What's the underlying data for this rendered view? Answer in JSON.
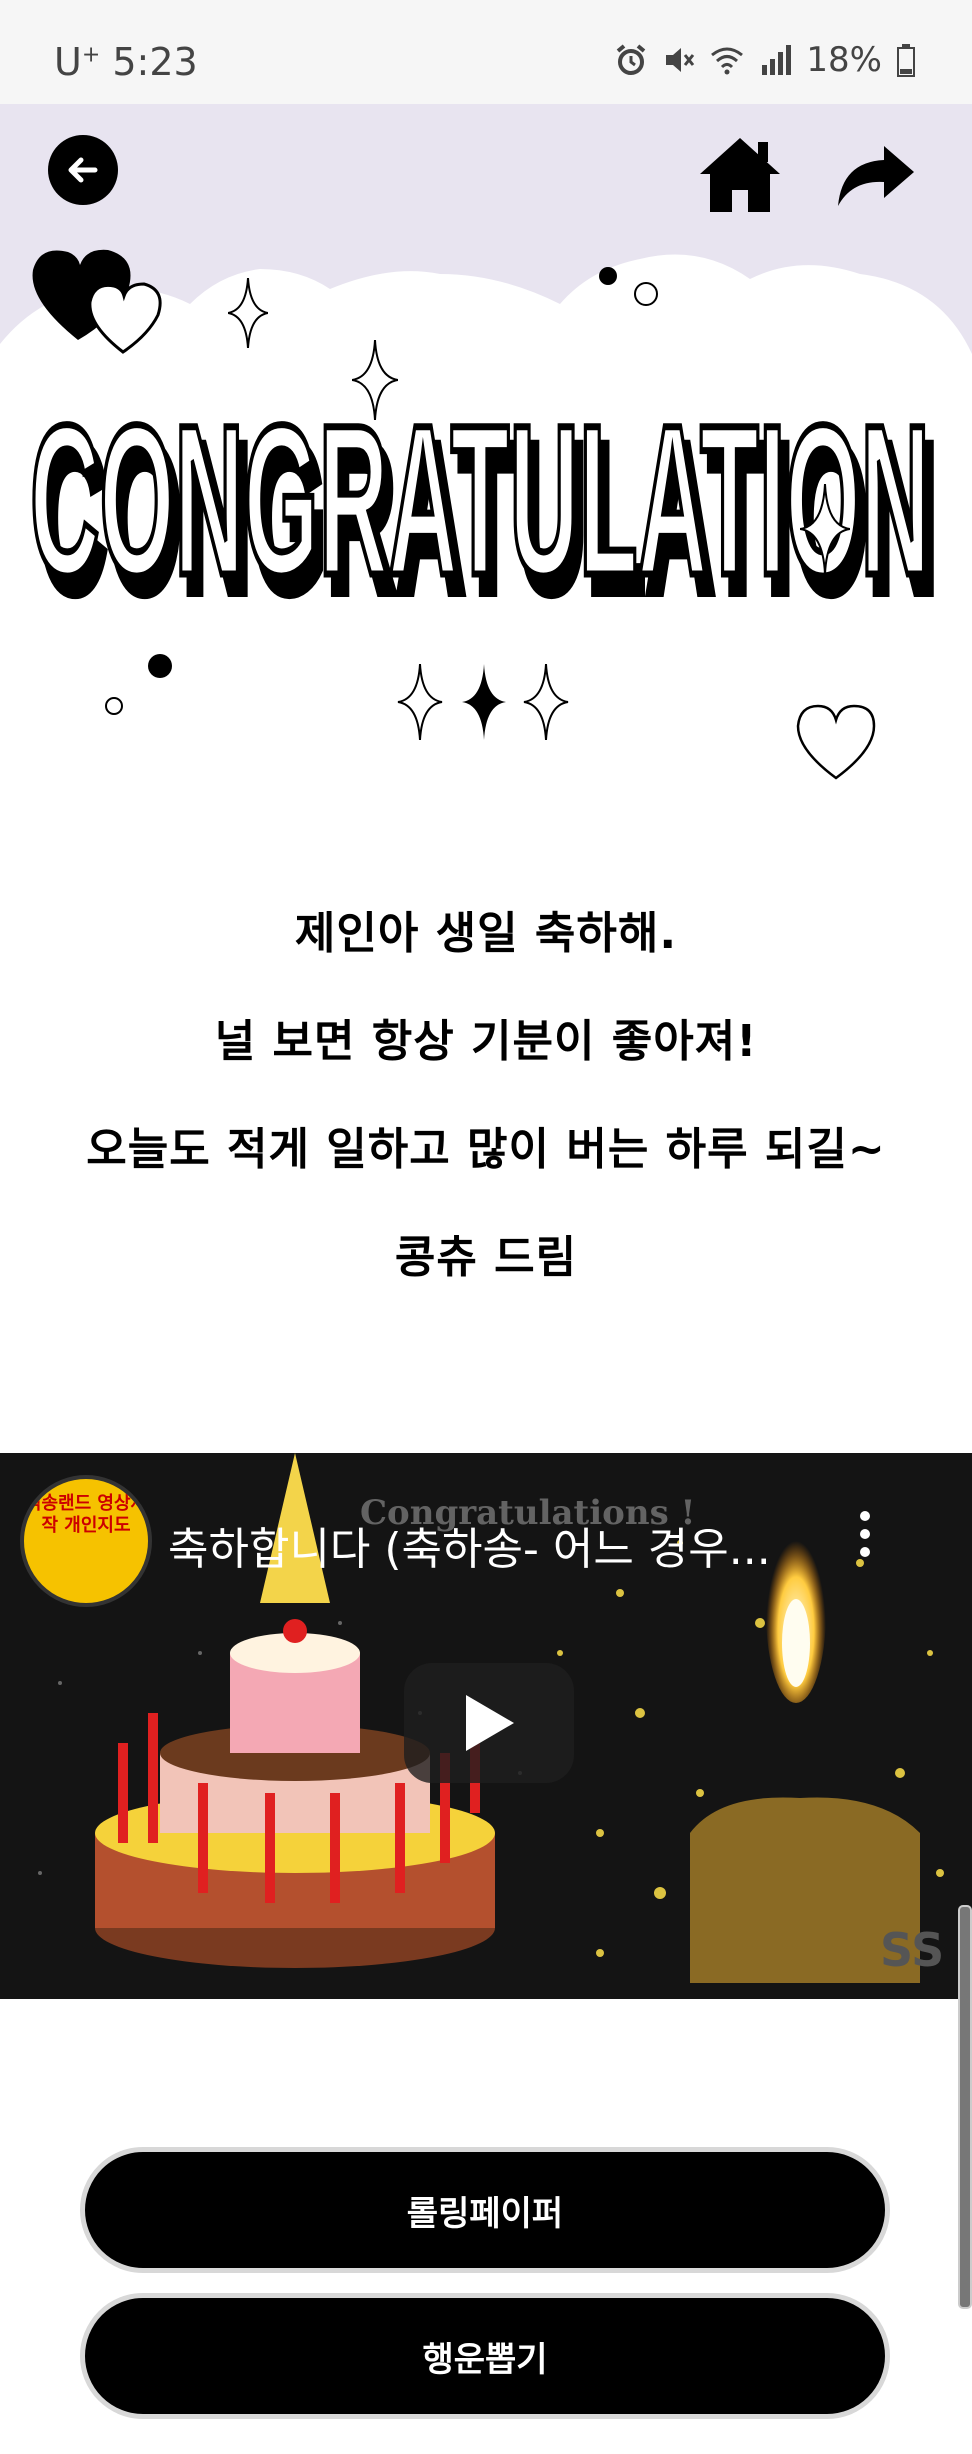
{
  "status_bar": {
    "carrier": "U",
    "carrier_sup": "+",
    "time": "5:23",
    "battery": "18%",
    "icons": [
      "alarm-icon",
      "mute-icon",
      "wifi-icon",
      "signal-icon",
      "battery-icon"
    ]
  },
  "header": {
    "back_icon": "arrow-left-icon",
    "home_icon": "home-icon",
    "share_icon": "share-icon",
    "banner_color": "#e8e4f0"
  },
  "title": "CONGRATULATION",
  "message": {
    "lines": [
      "제인아 생일 축하해.",
      "널 보면 항상 기분이 좋아져!",
      "오늘도 적게 일하고 많이 버는 하루 되길~",
      "콩츄 드림"
    ]
  },
  "video": {
    "title": "축하합니다 (축하송- 어느 경우...",
    "channel_text": "석송랜드 영상제작 개인지도",
    "watermark": "Congratulations !",
    "corner_text": "SS"
  },
  "buttons": {
    "rolling_paper": "롤링페이퍼",
    "lucky_draw": "행운뽑기"
  }
}
